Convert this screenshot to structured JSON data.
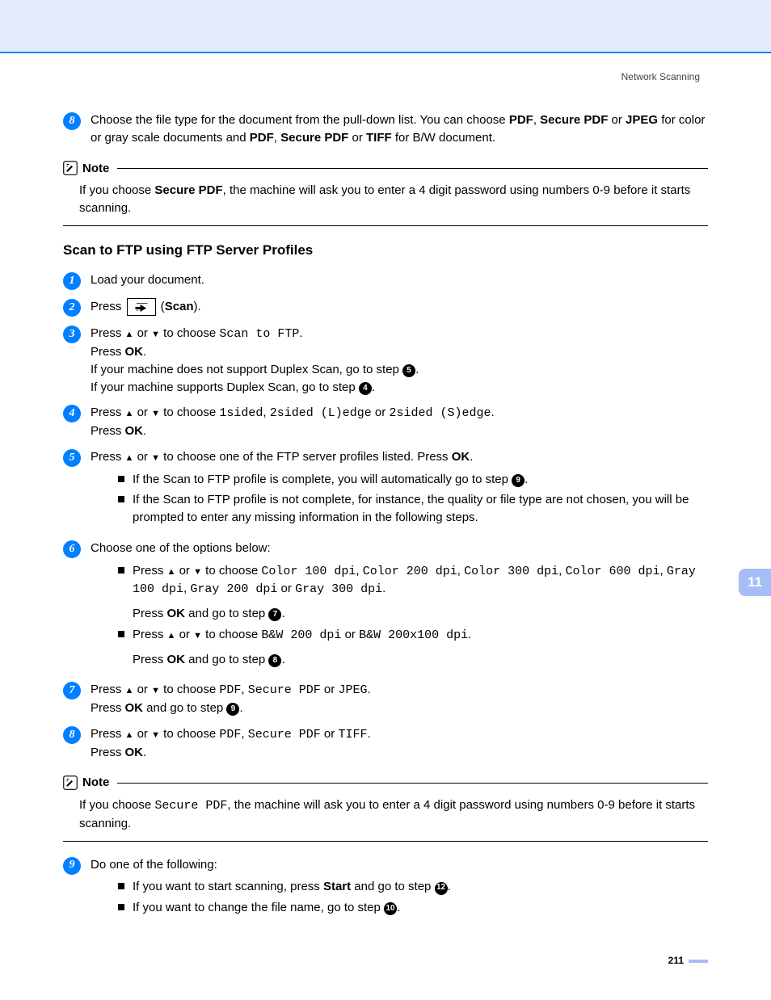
{
  "header": {
    "title": "Network Scanning"
  },
  "chapter_tab": "11",
  "page_number": "211",
  "ui": {
    "up": "▲",
    "down": "▼",
    "or": " or ",
    "scan_label": "Scan",
    "start_label": "Start"
  },
  "step8_top": {
    "num": "8",
    "prefix": "Choose the file type for the document from the pull-down list. You can choose ",
    "pdf": "PDF",
    "sep1": ", ",
    "spdf": "Secure PDF",
    "sep2": " or ",
    "jpeg": "JPEG",
    "mid": " for color or gray scale documents and ",
    "tiff": "TIFF",
    "suffix": " for B/W document."
  },
  "note1": {
    "label": "Note",
    "prefix": "If you choose ",
    "spdf": "Secure PDF",
    "rest": ", the machine will ask you to enter a 4 digit password using numbers 0-9 before it starts scanning."
  },
  "heading": "Scan to FTP using FTP Server Profiles",
  "steps": {
    "s1": {
      "num": "1",
      "text": "Load your document."
    },
    "s2": {
      "num": "2",
      "press": "Press ",
      "paren_open": " (",
      "paren_close": ")."
    },
    "s3": {
      "num": "3",
      "l1a": "Press ",
      "l1b": " to choose ",
      "code": "Scan to FTP",
      "dot": ".",
      "l2a": "Press ",
      "ok": "OK",
      "l3a": "If your machine does not support Duplex Scan, go to step ",
      "ref5": "5",
      "l4a": "If your machine supports Duplex Scan, go to step ",
      "ref4": "4"
    },
    "s4": {
      "num": "4",
      "l1a": "Press ",
      "l1b": " to choose ",
      "opt1": "1sided",
      "sep1": ", ",
      "opt2": "2sided (L)edge",
      "or": " or ",
      "opt3": "2sided (S)edge",
      "dot": ".",
      "l2a": "Press ",
      "ok": "OK"
    },
    "s5": {
      "num": "5",
      "l1a": "Press ",
      "l1b": " to choose one of the FTP server profiles listed. Press ",
      "ok": "OK",
      "dot": ".",
      "b1": "If the Scan to FTP profile is complete, you will automatically go to step ",
      "ref9": "9",
      "b2": "If the Scan to FTP profile is not complete, for instance, the quality or file type are not chosen, you will be prompted to enter any missing information in the following steps."
    },
    "s6": {
      "num": "6",
      "l1": "Choose one of the options below:",
      "b1a": "Press ",
      "b1b": " to choose ",
      "c100": "Color 100 dpi",
      "c200": "Color 200 dpi",
      "c300": "Color 300 dpi",
      "c600": "Color 600 dpi",
      "g100": "Gray 100 dpi",
      "g200": "Gray 200 dpi",
      "g300": "Gray 300 dpi",
      "comma": ", ",
      "or": " or ",
      "dot": ".",
      "press_ok": "Press ",
      "ok": "OK",
      "goto": " and go to step ",
      "ref7": "7",
      "b2a": "Press ",
      "b2b": " to choose ",
      "bw1": "B&W 200 dpi",
      "bw2": "B&W 200x100 dpi",
      "ref8": "8"
    },
    "s7": {
      "num": "7",
      "l1a": "Press ",
      "l1b": " to choose ",
      "o1": "PDF",
      "o2": "Secure PDF",
      "o3": "JPEG",
      "comma": ", ",
      "or": " or ",
      "dot": ".",
      "l2a": "Press ",
      "ok": "OK",
      "goto": " and go to step ",
      "ref9": "9"
    },
    "s8": {
      "num": "8",
      "l1a": "Press ",
      "l1b": " to choose ",
      "o1": "PDF",
      "o2": "Secure PDF",
      "o3": "TIFF",
      "comma": ", ",
      "or": " or ",
      "dot": ".",
      "l2a": "Press ",
      "ok": "OK"
    },
    "s9": {
      "num": "9",
      "l1": "Do one of the following:",
      "b1a": "If you want to start scanning, press ",
      "b1b": " and go to step ",
      "ref12": "12",
      "b2a": "If you want to change the file name, go to step ",
      "ref10": "10"
    }
  },
  "note2": {
    "label": "Note",
    "prefix": "If you choose ",
    "spdf": "Secure PDF",
    "rest": ", the machine will ask you to enter a 4 digit password using numbers 0-9 before it starts scanning."
  }
}
